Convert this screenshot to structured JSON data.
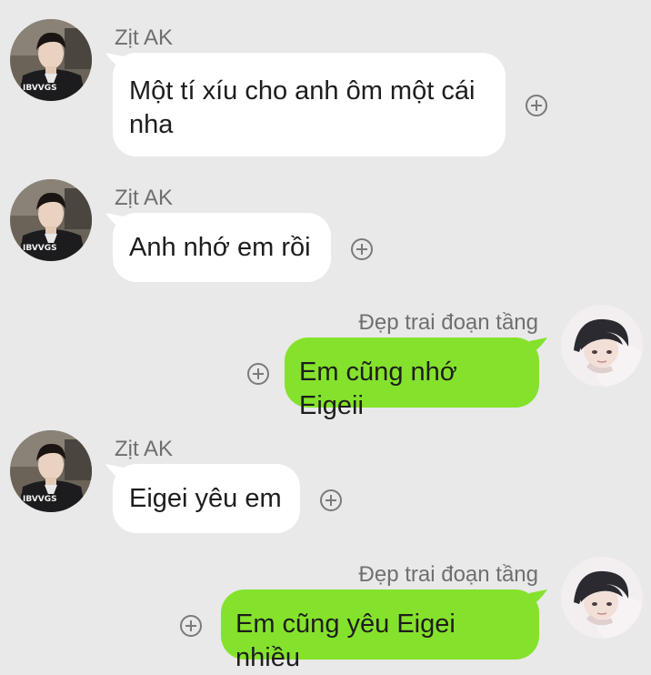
{
  "messages": [
    {
      "direction": "incoming",
      "sender": "Zịt AK",
      "text": "Một tí xíu cho anh ôm một cái nha",
      "avatar": "boy-avatar"
    },
    {
      "direction": "incoming",
      "sender": "Zịt AK",
      "text": "Anh nhớ em rồi",
      "avatar": "boy-avatar"
    },
    {
      "direction": "outgoing",
      "sender": "Đẹp trai đoạn tầng",
      "text": "Em cũng nhớ Eigeii",
      "avatar": "girl-avatar"
    },
    {
      "direction": "incoming",
      "sender": "Zịt AK",
      "text": "Eigei yêu em",
      "avatar": "boy-avatar"
    },
    {
      "direction": "outgoing",
      "sender": "Đẹp trai đoạn tầng",
      "text": "Em cũng yêu Eigei nhiều",
      "avatar": "girl-avatar"
    }
  ],
  "reaction_icon": "plus-circle-icon",
  "colors": {
    "background": "#e9e9e9",
    "incoming_bubble": "#ffffff",
    "outgoing_bubble": "#85e22c",
    "sender_text": "#6f6f6f"
  }
}
